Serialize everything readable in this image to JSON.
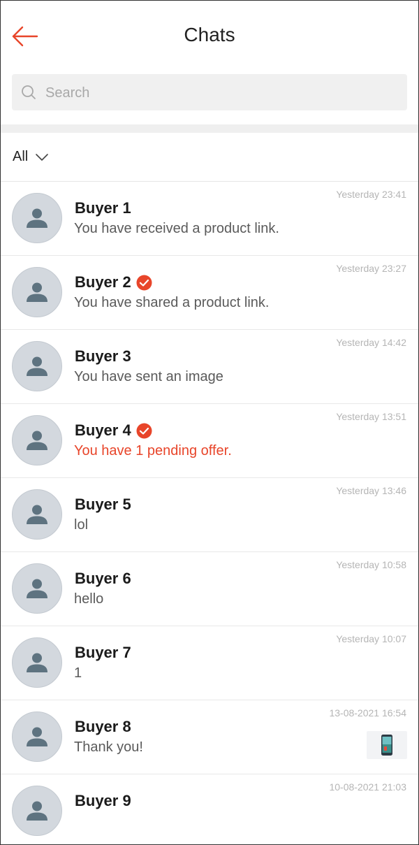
{
  "header": {
    "title": "Chats"
  },
  "search": {
    "placeholder": "Search"
  },
  "filter": {
    "label": "All"
  },
  "colors": {
    "accent": "#e8452a",
    "avatar_bg": "#d3d8de",
    "avatar_icon": "#5e7380"
  },
  "chats": [
    {
      "name": "Buyer 1",
      "preview": "You have received a product link.",
      "time": "Yesterday 23:41"
    },
    {
      "name": "Buyer 2",
      "preview": "You have shared a product link.",
      "time": "Yesterday 23:27"
    },
    {
      "name": "Buyer 3",
      "preview": "You have sent an image",
      "time": "Yesterday 14:42"
    },
    {
      "name": "Buyer 4",
      "preview": "You have 1 pending offer.",
      "time": "Yesterday 13:51"
    },
    {
      "name": "Buyer 5",
      "preview": "lol",
      "time": "Yesterday 13:46"
    },
    {
      "name": "Buyer 6",
      "preview": "hello",
      "time": "Yesterday 10:58"
    },
    {
      "name": "Buyer 7",
      "preview": "1",
      "time": "Yesterday 10:07"
    },
    {
      "name": "Buyer 8",
      "preview": "Thank you!",
      "time": "13-08-2021 16:54"
    },
    {
      "name": "Buyer 9",
      "preview": "",
      "time": "10-08-2021 21:03"
    }
  ]
}
